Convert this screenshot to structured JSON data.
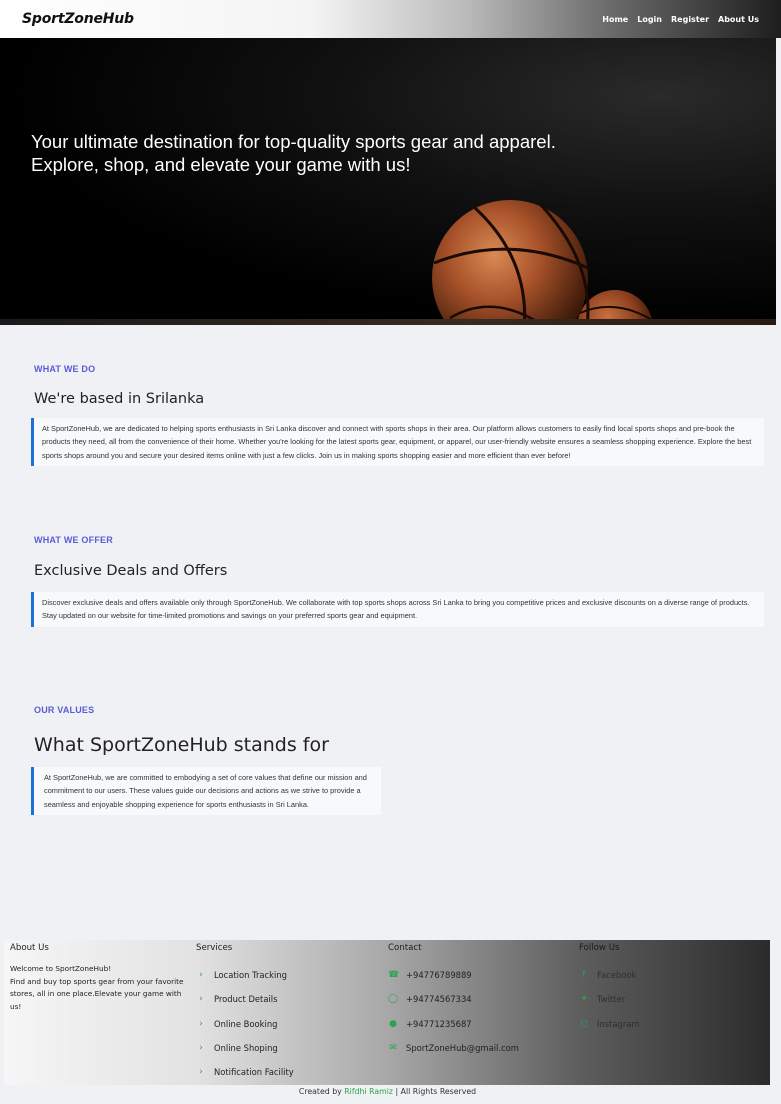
{
  "navbar": {
    "brand": "SportZoneHub",
    "links": [
      "Home",
      "Login",
      "Register",
      "About Us"
    ]
  },
  "hero": {
    "line1": "Your ultimate destination for top-quality sports gear and apparel.",
    "line2": "Explore, shop, and elevate your game with us!"
  },
  "what_we_do": {
    "eyebrow": "WHAT WE DO",
    "title": "We're based in Srilanka",
    "text": "At SportZoneHub, we are dedicated to helping sports enthusiasts in Sri Lanka discover and connect with sports shops in their area. Our platform allows customers to easily find local sports shops and pre-book the products they need, all from the convenience of their home. Whether you're looking for the latest sports gear, equipment, or apparel, our user-friendly website ensures a seamless shopping experience. Explore the best sports shops around you and secure your desired items online with just a few clicks. Join us in making sports shopping easier and more efficient than ever before!"
  },
  "what_we_offer": {
    "eyebrow": "WHAT WE OFFER",
    "title": "Exclusive Deals and Offers",
    "text": "Discover exclusive deals and offers available only through SportZoneHub. We collaborate with top sports shops across Sri Lanka to bring you competitive prices and exclusive discounts on a diverse range of products. Stay updated on our website for time-limited promotions and savings on your preferred sports gear and equipment."
  },
  "our_values": {
    "eyebrow": "OUR VALUES",
    "title": "What SportZoneHub stands for",
    "text": "At SportZoneHub, we are committed to embodying a set of core values that define our mission and commitment to our users. These values guide our decisions and actions as we strive to provide a seamless and enjoyable shopping experience for sports enthusiasts in Sri Lanka."
  },
  "footer": {
    "about": {
      "heading": "About Us",
      "line1": "Welcome to SportZoneHub!",
      "line2": "Find and buy top sports gear from your favorite stores, all in one place.Elevate your game with us!"
    },
    "services": {
      "heading": "Services",
      "items": [
        "Location Tracking",
        "Product Details",
        "Online Booking",
        "Online Shoping",
        "Notification Facility"
      ]
    },
    "contact": {
      "heading": "Contact",
      "items": [
        "+94776789889",
        "+94774567334",
        "+94771235687",
        "SportZoneHub@gmail.com"
      ]
    },
    "follow": {
      "heading": "Follow Us",
      "items": [
        "Facebook",
        "Twitter",
        "Instagram"
      ]
    },
    "credit_prefix": "Created by",
    "credit_author": "Rifdhi Ramiz",
    "credit_suffix": "| All Rights Reserved"
  },
  "colors": {
    "accent": "#5b5bd6",
    "quote_border": "#1f6fd9",
    "contact_icon": "#2aa34a"
  },
  "icons": {
    "service": "chevron-right-icon",
    "contact": [
      "phone-icon",
      "whatsapp-icon",
      "viber-icon",
      "envelope-icon"
    ],
    "follow": [
      "facebook-icon",
      "twitter-icon",
      "instagram-icon"
    ]
  }
}
